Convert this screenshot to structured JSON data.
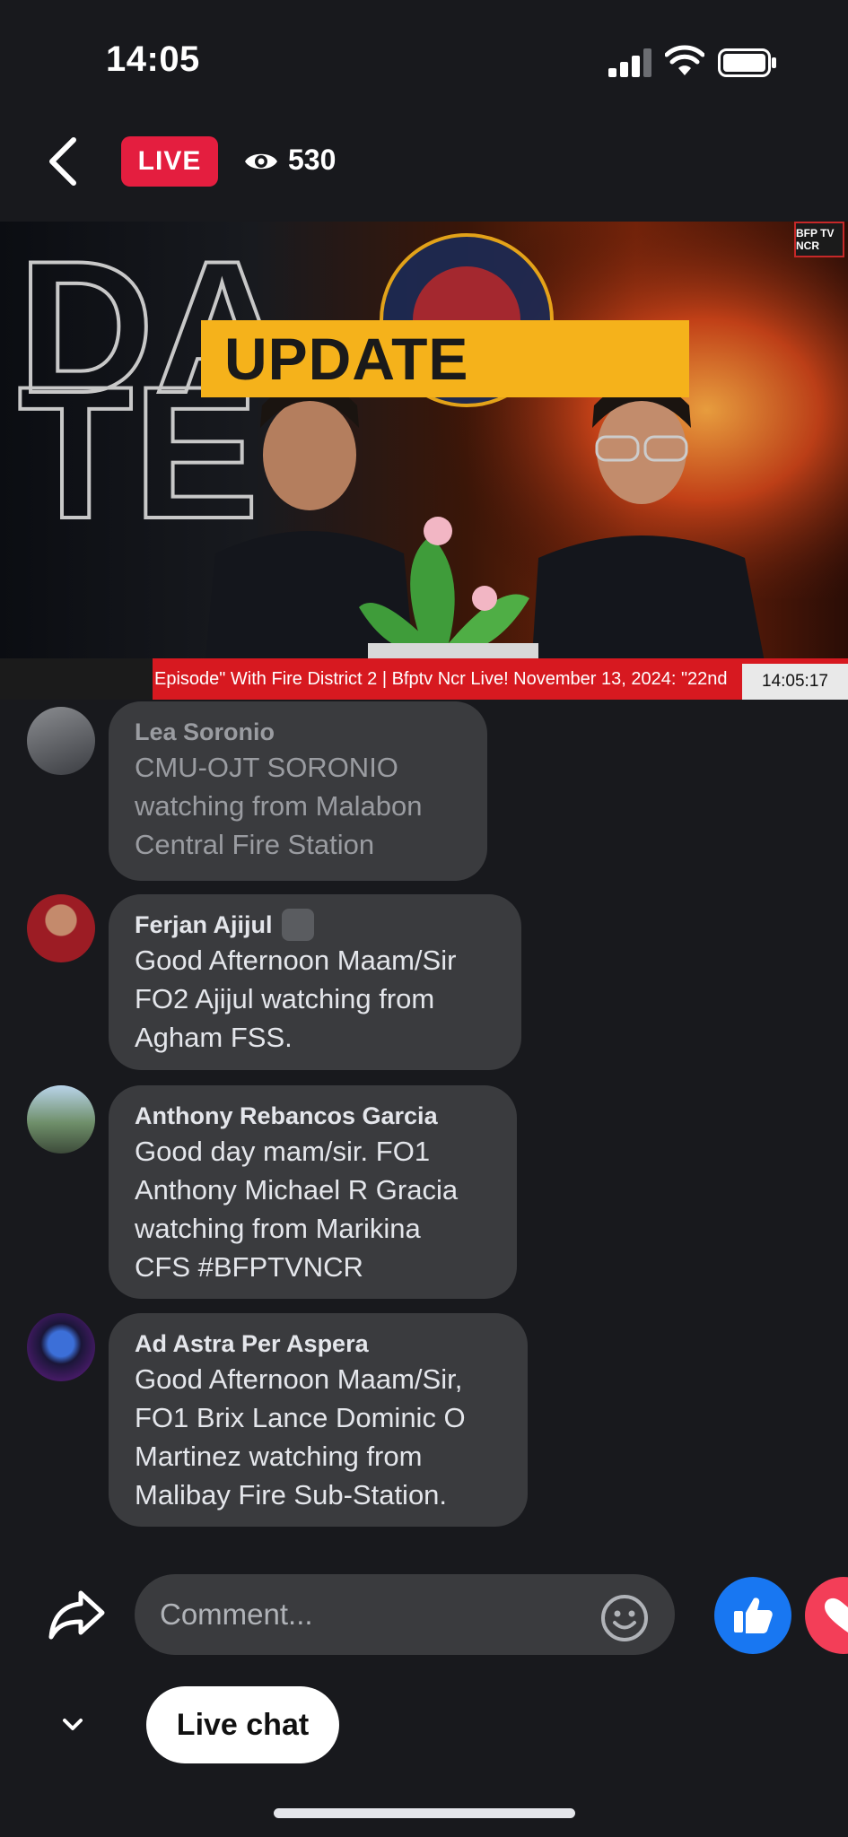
{
  "status_bar": {
    "time": "14:05"
  },
  "header": {
    "live_label": "LIVE",
    "viewer_count": "530"
  },
  "video": {
    "banner_text": "UPDATE",
    "corner_logo": "BFP TV NCR",
    "ticker_text": "Episode\" With Fire District 2  |  Bfptv Ncr Live! November 13, 2024:   \"22nd",
    "ticker_clock": "14:05:17"
  },
  "comments": [
    {
      "author": "Lea Soronio",
      "text": "CMU-OJT SORONIO\nwatching from Malabon\nCentral Fire Station",
      "faded": true
    },
    {
      "author": "Ferjan Ajijul",
      "text": "Good Afternoon Maam/Sir\nFO2 Ajijul watching from\nAgham FSS.",
      "badge": true
    },
    {
      "author": "Anthony Rebancos Garcia",
      "text": "Good day mam/sir. FO1\nAnthony Michael R Gracia\nwatching from Marikina\nCFS #BFPTVNCR"
    },
    {
      "author": "Ad Astra Per Aspera",
      "text": "Good Afternoon Maam/Sir,\nFO1 Brix Lance Dominic O\nMartinez watching from\nMalibay Fire Sub-Station."
    }
  ],
  "composer": {
    "placeholder": "Comment..."
  },
  "footer": {
    "live_chat_label": "Live chat"
  },
  "colors": {
    "live_red": "#e41e3f",
    "like_blue": "#1877f2",
    "love_pink": "#f33e58",
    "bubble": "#3a3b3e"
  }
}
